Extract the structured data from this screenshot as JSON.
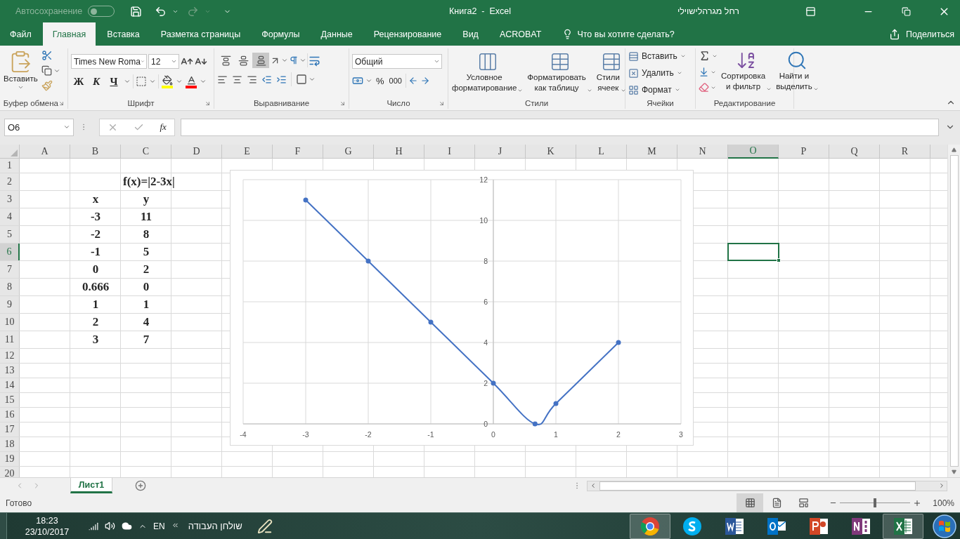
{
  "title_bar": {
    "autosave_label": "Автосохранение",
    "autosave_on": false,
    "title": "Книга2  -  Excel",
    "user": "רחל מגרהלישוילי"
  },
  "menu_tabs": [
    {
      "label": "Файл",
      "selected": false
    },
    {
      "label": "Главная",
      "selected": true
    },
    {
      "label": "Вставка",
      "selected": false
    },
    {
      "label": "Разметка страницы",
      "selected": false
    },
    {
      "label": "Формулы",
      "selected": false
    },
    {
      "label": "Данные",
      "selected": false
    },
    {
      "label": "Рецензирование",
      "selected": false
    },
    {
      "label": "Вид",
      "selected": false
    },
    {
      "label": "ACROBAT",
      "selected": false
    }
  ],
  "tell_me": "Что вы хотите сделать?",
  "share": "Поделиться",
  "ribbon": {
    "clipboard": {
      "paste": "Вставить",
      "label": "Буфер обмена"
    },
    "font": {
      "name": "Times New Roma",
      "size": "12",
      "bold": "Ж",
      "italic": "К",
      "underline": "Ч",
      "label": "Шрифт"
    },
    "alignment": {
      "vertical": [
        {
          "kind": "top",
          "selected": false
        },
        {
          "kind": "middle",
          "selected": false
        },
        {
          "kind": "bottom",
          "selected": true
        }
      ],
      "label": "Выравнивание"
    },
    "number": {
      "format": "Общий",
      "percent": "%",
      "thousands": "000",
      "label": "Число"
    },
    "styles": {
      "buttons": [
        {
          "kind": "conditional",
          "lines": [
            "Условное",
            "форматирование"
          ]
        },
        {
          "kind": "table",
          "lines": [
            "Форматировать",
            "как таблицу"
          ]
        },
        {
          "kind": "cell",
          "lines": [
            "Стили",
            "ячеек"
          ]
        }
      ],
      "label": "Стили"
    },
    "cells": {
      "items": [
        {
          "kind": "insert",
          "label": "Вставить"
        },
        {
          "kind": "delete",
          "label": "Удалить"
        },
        {
          "kind": "format",
          "label": "Формат"
        }
      ],
      "label": "Ячейки"
    },
    "editing": {
      "buttons": [
        {
          "kind": "sort",
          "lines": [
            "Сортировка",
            "и фильтр"
          ]
        },
        {
          "kind": "find",
          "lines": [
            "Найти и",
            "выделить"
          ]
        }
      ],
      "label": "Редактирование"
    }
  },
  "formula_bar": {
    "name_box": "O6",
    "function_label": "fx"
  },
  "columns": [
    {
      "label": "A",
      "selected": false
    },
    {
      "label": "B",
      "selected": false
    },
    {
      "label": "C",
      "selected": false
    },
    {
      "label": "D",
      "selected": false
    },
    {
      "label": "E",
      "selected": false
    },
    {
      "label": "F",
      "selected": false
    },
    {
      "label": "G",
      "selected": false
    },
    {
      "label": "H",
      "selected": false
    },
    {
      "label": "I",
      "selected": false
    },
    {
      "label": "J",
      "selected": false
    },
    {
      "label": "K",
      "selected": false
    },
    {
      "label": "L",
      "selected": false
    },
    {
      "label": "M",
      "selected": false
    },
    {
      "label": "N",
      "selected": false
    },
    {
      "label": "O",
      "selected": true
    },
    {
      "label": "P",
      "selected": false
    },
    {
      "label": "Q",
      "selected": false
    },
    {
      "label": "R",
      "selected": false
    }
  ],
  "rows": [
    {
      "label": "1",
      "selected": false
    },
    {
      "label": "2",
      "selected": false,
      "c": "f(x)=|2-3x|"
    },
    {
      "label": "3",
      "selected": false,
      "b": "x",
      "c": "y"
    },
    {
      "label": "4",
      "selected": false,
      "b": "-3",
      "c": "11"
    },
    {
      "label": "5",
      "selected": false,
      "b": "-2",
      "c": "8"
    },
    {
      "label": "6",
      "selected": true,
      "b": "-1",
      "c": "5"
    },
    {
      "label": "7",
      "selected": false,
      "b": "0",
      "c": "2"
    },
    {
      "label": "8",
      "selected": false,
      "b": "0.666",
      "c": "0"
    },
    {
      "label": "9",
      "selected": false,
      "b": "1",
      "c": "1"
    },
    {
      "label": "10",
      "selected": false,
      "b": "2",
      "c": "4"
    },
    {
      "label": "11",
      "selected": false,
      "b": "3",
      "c": "7"
    },
    {
      "label": "12",
      "selected": false
    },
    {
      "label": "13",
      "selected": false
    },
    {
      "label": "14",
      "selected": false
    },
    {
      "label": "15",
      "selected": false
    },
    {
      "label": "16",
      "selected": false
    },
    {
      "label": "17",
      "selected": false
    },
    {
      "label": "18",
      "selected": false
    },
    {
      "label": "19",
      "selected": false
    },
    {
      "label": "20",
      "selected": false
    }
  ],
  "chart": {
    "chart_data": {
      "type": "line",
      "grid": true,
      "x": [
        -3,
        -2,
        -1,
        0,
        0.666,
        1,
        2
      ],
      "series": [
        {
          "color": "#4472c4",
          "marker": true,
          "values": [
            11,
            8,
            5,
            2,
            0,
            1,
            4
          ]
        }
      ],
      "xlim": [
        -4,
        3
      ],
      "ylim": [
        0,
        12
      ],
      "xticks": [
        -4,
        -3,
        -2,
        -1,
        0,
        1,
        2,
        3
      ],
      "yticks": [
        0,
        2,
        4,
        6,
        8,
        10,
        12
      ]
    }
  },
  "sheet_tabs": [
    {
      "label": "Лист1",
      "selected": true
    }
  ],
  "status_bar": {
    "status": "Готово",
    "views": [
      {
        "kind": "normal",
        "selected": true
      },
      {
        "kind": "layout",
        "selected": false
      },
      {
        "kind": "pagebreak",
        "selected": false
      }
    ],
    "zoom": {
      "level": 0.5,
      "reading": "100%"
    }
  },
  "taskbar": {
    "time": "18:23",
    "date": "23/10/2017",
    "language": "EN",
    "toolbar": "שולחן העבודה",
    "apps": [
      {
        "kind": "browser",
        "selected": true
      },
      {
        "kind": "chat",
        "selected": false
      },
      {
        "kind": "document",
        "selected": false
      },
      {
        "kind": "mail",
        "selected": false
      },
      {
        "kind": "slides",
        "selected": false
      },
      {
        "kind": "notebook",
        "selected": false
      },
      {
        "kind": "spreadsheet",
        "selected": true
      }
    ]
  }
}
